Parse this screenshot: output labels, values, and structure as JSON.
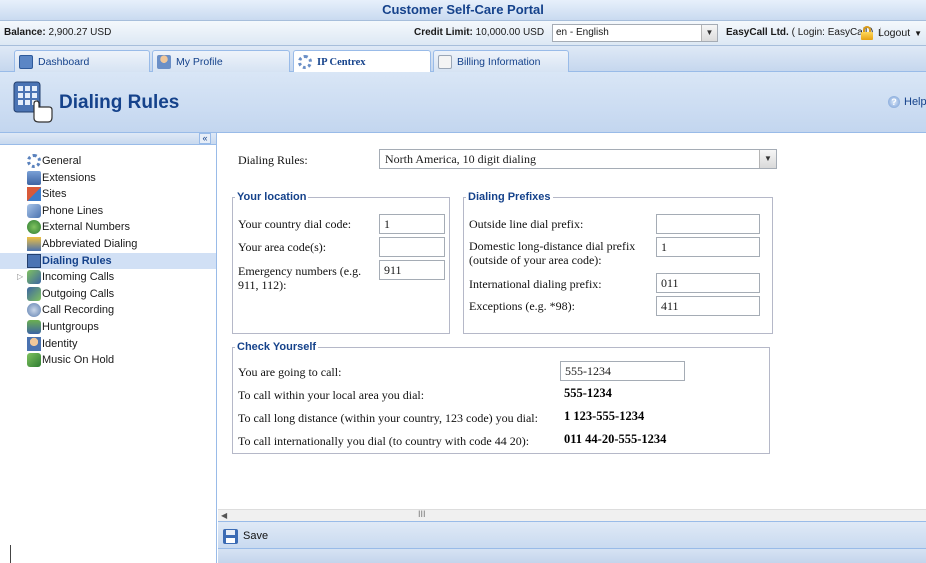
{
  "window": {
    "title": "Customer Self-Care Portal"
  },
  "account": {
    "balance_label": "Balance:",
    "balance_value": "2,900.27 USD",
    "credit_label": "Credit Limit:",
    "credit_value": "10,000.00 USD",
    "language": "en - English",
    "company": "EasyCall Ltd.",
    "login_info": "( Login: EasyCall )",
    "logout_label": "Logout"
  },
  "tabs": [
    {
      "label": "Dashboard",
      "icon": "dashboard-icon",
      "active": false
    },
    {
      "label": "My Profile",
      "icon": "user-icon",
      "active": false
    },
    {
      "label": "IP Centrex",
      "icon": "gears-icon",
      "active": true
    },
    {
      "label": "Billing Information",
      "icon": "document-icon",
      "active": false
    }
  ],
  "page": {
    "title": "Dialing Rules",
    "help_label": "Help"
  },
  "sidebar": {
    "collapse_glyph": "«",
    "items": [
      {
        "label": "General",
        "icon": "gear-icon"
      },
      {
        "label": "Extensions",
        "icon": "extensions-icon"
      },
      {
        "label": "Sites",
        "icon": "sites-icon"
      },
      {
        "label": "Phone Lines",
        "icon": "phone-lines-icon"
      },
      {
        "label": "External Numbers",
        "icon": "external-numbers-icon"
      },
      {
        "label": "Abbreviated Dialing",
        "icon": "abbreviated-dialing-icon"
      },
      {
        "label": "Dialing Rules",
        "icon": "dialing-rules-icon",
        "selected": true
      },
      {
        "label": "Incoming Calls",
        "icon": "incoming-calls-icon",
        "expandable": true
      },
      {
        "label": "Outgoing Calls",
        "icon": "outgoing-calls-icon"
      },
      {
        "label": "Call Recording",
        "icon": "call-recording-icon"
      },
      {
        "label": "Huntgroups",
        "icon": "huntgroups-icon"
      },
      {
        "label": "Identity",
        "icon": "identity-icon"
      },
      {
        "label": "Music On Hold",
        "icon": "music-icon"
      }
    ]
  },
  "form": {
    "dialing_rules_label": "Dialing Rules:",
    "dialing_rules_value": "North America, 10 digit dialing",
    "location": {
      "legend": "Your location",
      "country_code_label": "Your country dial code:",
      "country_code_value": "1",
      "area_code_label": "Your area code(s):",
      "area_code_value": "",
      "emergency_label_line1": "Emergency numbers (e.g.",
      "emergency_label_line2": "911, 112):",
      "emergency_value": "911"
    },
    "prefixes": {
      "legend": "Dialing Prefixes",
      "outside_line_label": "Outside line dial prefix:",
      "outside_line_value": "",
      "domestic_label_line1": "Domestic long-distance dial prefix",
      "domestic_label_line2": "(outside of your area code):",
      "domestic_value": "1",
      "international_label": "International dialing prefix:",
      "international_value": "011",
      "exceptions_label": "Exceptions (e.g. *98):",
      "exceptions_value": "411"
    },
    "check": {
      "legend": "Check Yourself",
      "going_to_call_label": "You are going to call:",
      "going_to_call_value": "555-1234",
      "local_label": "To call within your local area you dial:",
      "local_result": "555-1234",
      "long_distance_label": "To call long distance (within your country, 123 code) you dial:",
      "long_distance_result": "1 123-555-1234",
      "international_label": "To call internationally you dial (to country with code 44 20):",
      "international_result": "011 44-20-555-1234"
    }
  },
  "toolbar": {
    "save_label": "Save"
  },
  "colors": {
    "accent": "#15428b",
    "panel": "#c9daf0",
    "border": "#99bbe8",
    "selected": "#d1e0f5"
  }
}
